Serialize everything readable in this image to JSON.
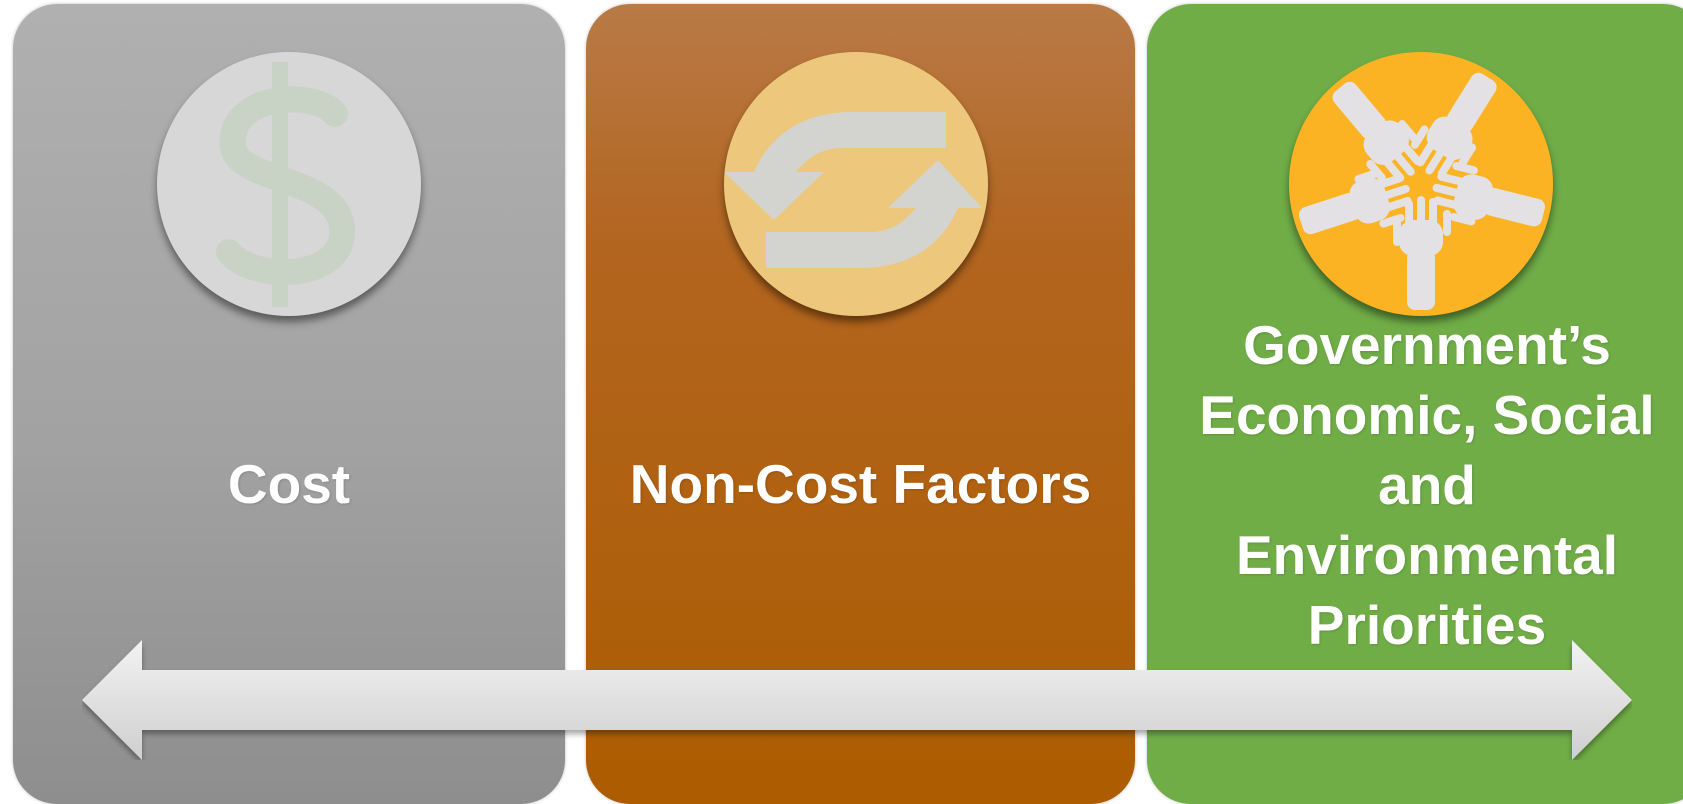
{
  "panels": {
    "cost": {
      "label": "Cost",
      "color": "#a2a2a2",
      "icon": "dollar-sign-icon"
    },
    "noncost": {
      "label": "Non-Cost Factors",
      "color": "#ad5c00",
      "icon": "refresh-cycle-icon"
    },
    "gov": {
      "label_lines": [
        "Government’s",
        "Economic, Social",
        "and",
        "Environmental",
        "Priorities"
      ],
      "color": "#70ad47",
      "icon": "hands-together-icon"
    }
  },
  "arrow": {
    "icon": "double-headed-arrow-icon",
    "color": "#dcdcdc"
  }
}
